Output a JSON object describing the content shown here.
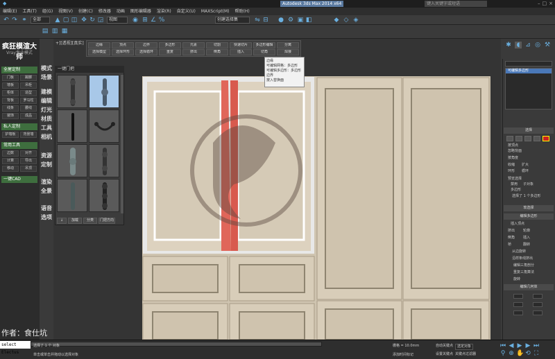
{
  "titlebar": {
    "text": "Autodesk 3ds Max 2014 x64",
    "search_placeholder": "键入关键字或短语"
  },
  "menubar": [
    "编辑(E)",
    "工具(T)",
    "组(G)",
    "视图(V)",
    "创建(C)",
    "修改器",
    "动画",
    "图形编辑器",
    "渲染(R)",
    "自定义(U)",
    "MAXScript(M)",
    "帮助(H)"
  ],
  "toolbar": {
    "selection_filter": "全部",
    "view_dropdown": "视图",
    "named_set": "创建选择集"
  },
  "leftpanel": {
    "title": "疯狂模渲大师",
    "subtitle": "Vray专业模式",
    "sections": [
      {
        "head": "全屋定制",
        "buttons": [
          "门板",
          "踢脚",
          "墙板",
          "吊柜",
          "柜体",
          "造型",
          "背板",
          "罗马柱",
          "线条",
          "腰线",
          "装饰",
          "成品"
        ]
      },
      {
        "head": "私人定制",
        "buttons": [
          "护墙板",
          "背景墙"
        ]
      },
      {
        "head": "常用工具",
        "buttons": [
          "边数",
          "对齐",
          "计算",
          "导出",
          "移动",
          "吊顶"
        ]
      },
      {
        "head": "一键CAD",
        "buttons": []
      }
    ],
    "vtabs": [
      "模式",
      "场景",
      "建模",
      "编辑",
      "灯光",
      "材质",
      "工具",
      "相机",
      "资源",
      "定制",
      "渲染",
      "全景",
      "语音",
      "选项"
    ]
  },
  "viewport": {
    "label": "+][透视][真实]"
  },
  "poly_toolbar": {
    "row1": [
      "边缘",
      "顶点",
      "边界",
      "多边形",
      "元素",
      "切割",
      "快速切片",
      "多边形编辑",
      "分离"
    ],
    "row2": [
      "选择模型",
      "选择环形",
      "选择循环",
      "重复",
      "挤出",
      "倒角",
      "插入",
      "切角",
      "焊接"
    ]
  },
  "tooltip": [
    "边缘",
    "可编辑网格：多边形",
    "可编辑多边形：多边形",
    "边界",
    "按入替换面"
  ],
  "library": {
    "title": "一键门把",
    "buttons": [
      "↓",
      "加载",
      "分类",
      "门把方向"
    ]
  },
  "rightpanel": {
    "list_title": "可编辑多边形",
    "items": [
      "可编辑多边形"
    ],
    "rollouts": [
      "选择",
      "软选择",
      "编辑多边形",
      "编辑几何体"
    ],
    "select_info": "选择了 1 个多边形",
    "labels": [
      "按顶点",
      "忽略背面",
      "按角度",
      "收缩",
      "扩大",
      "环形",
      "循环",
      "预览选择",
      "禁用",
      "子对象",
      "多边形"
    ],
    "edit_labels": [
      "插入顶点",
      "挤出",
      "轮廓",
      "倒角",
      "插入",
      "桥",
      "翻转",
      "从边旋转",
      "沿样条线挤出",
      "编辑三角剖分",
      "重复三角算法",
      "旋转"
    ]
  },
  "statusbar": {
    "command": "select Electus",
    "message1": "选择了 1 个 对象",
    "message2": "单击或单击并拖动以选择对象",
    "grid": "栅格 = 10.0mm",
    "autokey": "自动关键点",
    "selected": "选定对象",
    "setkey": "设置关键点",
    "filter": "关键点过滤器",
    "addtime": "添加时间标记"
  },
  "author": "作者：食仕坑"
}
